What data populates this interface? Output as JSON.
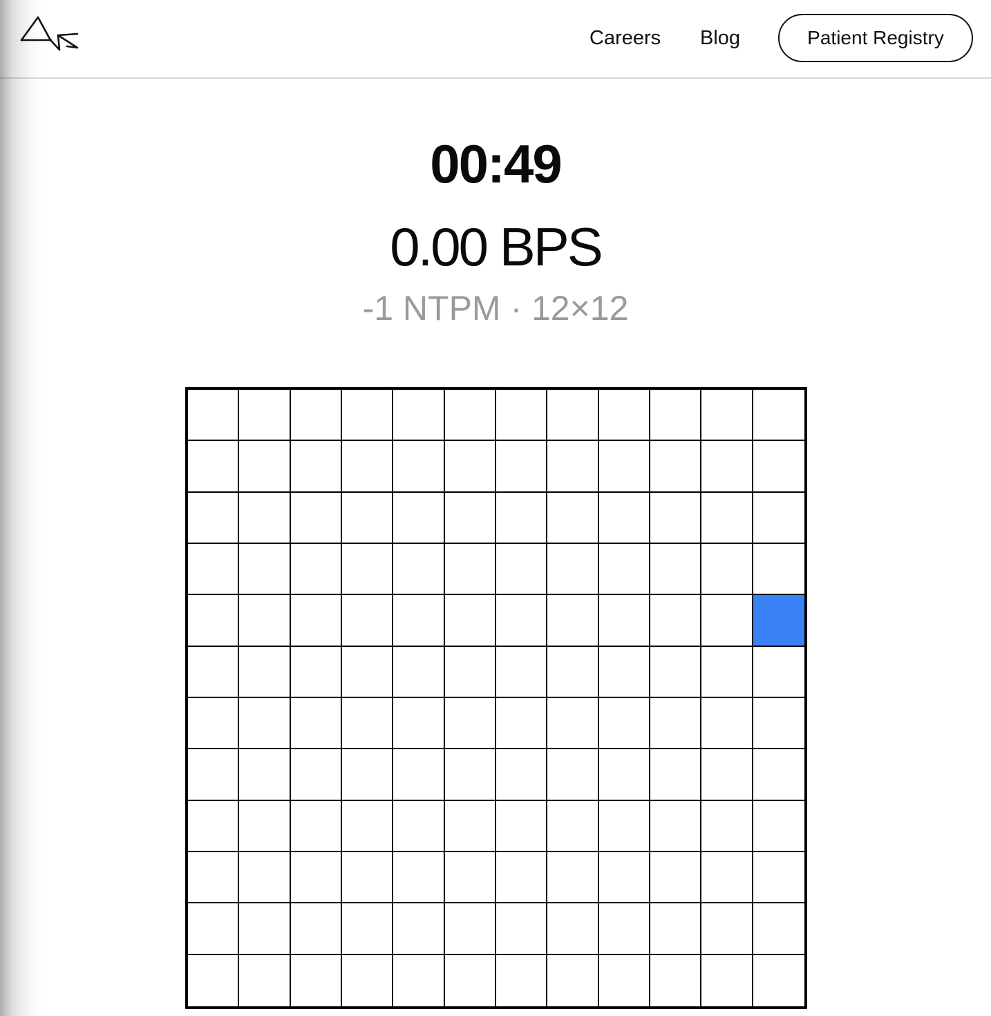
{
  "header": {
    "logo_icon": "neuralink-wave-logo",
    "nav": {
      "careers_label": "Careers",
      "blog_label": "Blog",
      "registry_label": "Patient Registry"
    }
  },
  "stats": {
    "timer": "00:49",
    "bps": "0.00 BPS",
    "meta": "-1 NTPM · 12×12"
  },
  "grid": {
    "rows": 12,
    "cols": 12,
    "target": {
      "row": 4,
      "col": 11
    },
    "target_color": "#3b82f6",
    "cell_color": "#ffffff",
    "line_color": "#000000"
  }
}
